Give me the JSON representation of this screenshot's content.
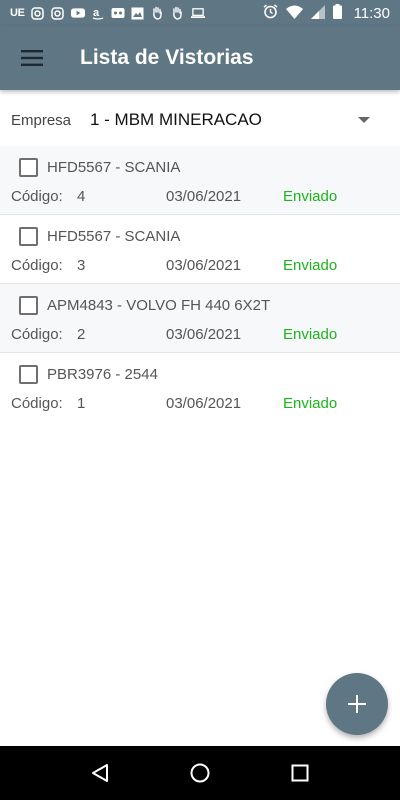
{
  "status_bar": {
    "carrier": "UE",
    "time": "11:30",
    "icons": [
      "instagram-icon",
      "instagram-icon",
      "youtube-icon",
      "amazon-icon",
      "voicemail-icon",
      "image-icon",
      "hand-icon",
      "hand-icon",
      "laptop-icon",
      "alarm-icon",
      "wifi-icon",
      "signal-icon",
      "battery-icon"
    ]
  },
  "app_bar": {
    "title": "Lista de Vistorias",
    "menu_icon": "hamburger-menu-icon"
  },
  "company": {
    "label": "Empresa",
    "value": "1 - MBM MINERACAO"
  },
  "items": [
    {
      "title": "HFD5567 - SCANIA",
      "code_label": "Código:",
      "code": "4",
      "date": "03/06/2021",
      "status": "Enviado"
    },
    {
      "title": "HFD5567 - SCANIA",
      "code_label": "Código:",
      "code": "3",
      "date": "03/06/2021",
      "status": "Enviado"
    },
    {
      "title": "APM4843 - VOLVO FH 440 6X2T",
      "code_label": "Código:",
      "code": "2",
      "date": "03/06/2021",
      "status": "Enviado"
    },
    {
      "title": "PBR3976 - 2544",
      "code_label": "Código:",
      "code": "1",
      "date": "03/06/2021",
      "status": "Enviado"
    }
  ],
  "fab": {
    "icon": "plus-icon"
  },
  "colors": {
    "primary": "#5f7684",
    "status_sent": "#1bb51b",
    "row_alt": "#f6f8fa"
  }
}
